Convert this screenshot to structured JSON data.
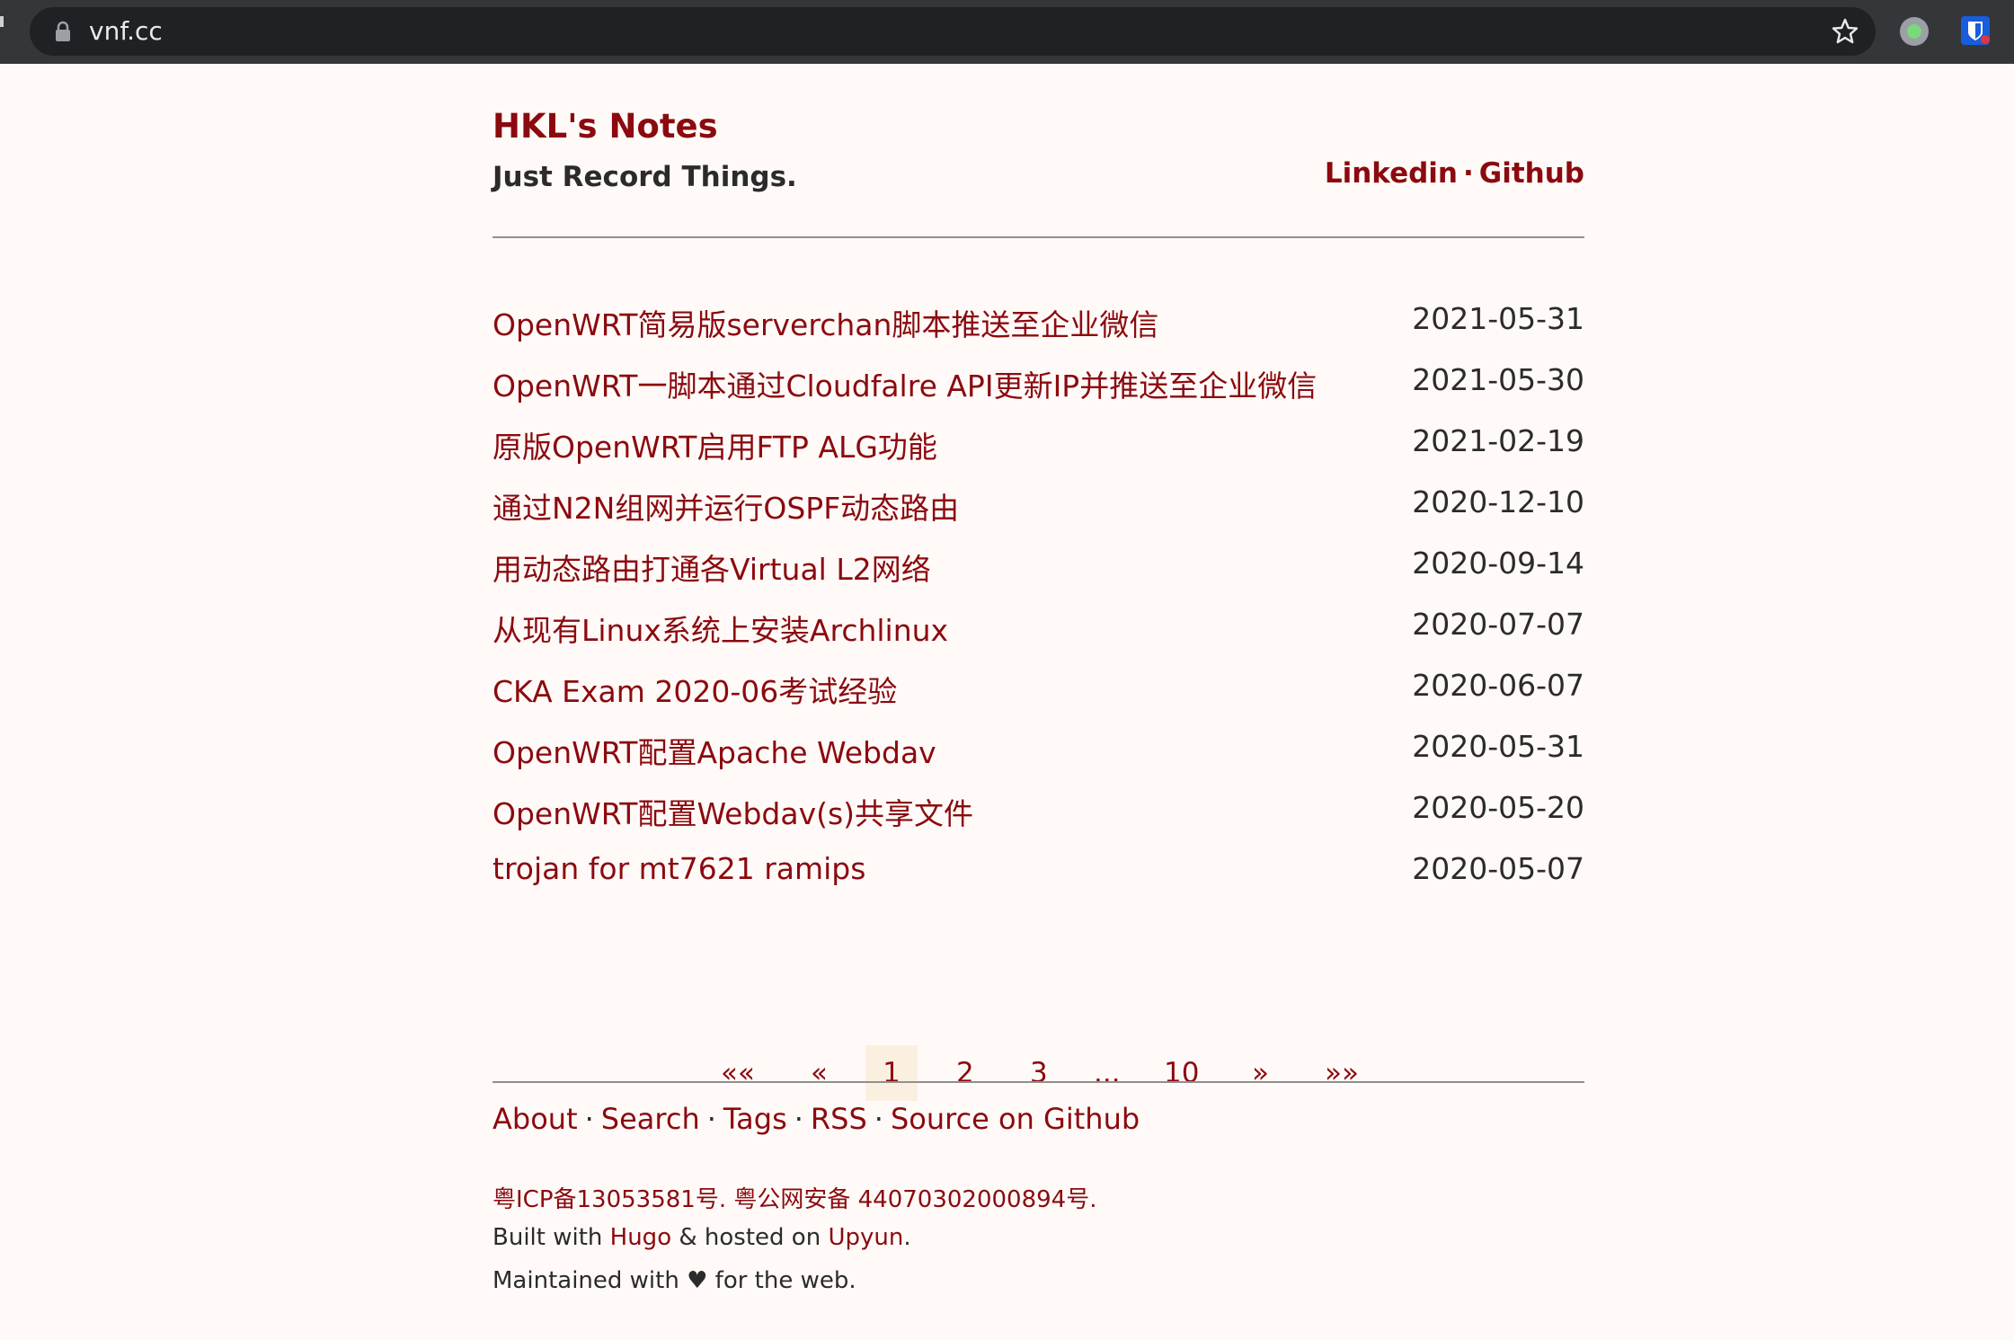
{
  "browser": {
    "url": "vnf.cc"
  },
  "header": {
    "title": "HKL's Notes",
    "subtitle": "Just Record Things.",
    "links": [
      "Linkedin",
      "Github"
    ],
    "separator": "·"
  },
  "posts": [
    {
      "title": "OpenWRT简易版serverchan脚本推送至企业微信",
      "date": "2021-05-31"
    },
    {
      "title": "OpenWRT一脚本通过Cloudfalre API更新IP并推送至企业微信",
      "date": "2021-05-30"
    },
    {
      "title": "原版OpenWRT启用FTP ALG功能",
      "date": "2021-02-19"
    },
    {
      "title": "通过N2N组网并运行OSPF动态路由",
      "date": "2020-12-10"
    },
    {
      "title": "用动态路由打通各Virtual L2网络",
      "date": "2020-09-14"
    },
    {
      "title": "从现有Linux系统上安装Archlinux",
      "date": "2020-07-07"
    },
    {
      "title": "CKA Exam 2020-06考试经验",
      "date": "2020-06-07"
    },
    {
      "title": "OpenWRT配置Apache Webdav",
      "date": "2020-05-31"
    },
    {
      "title": "OpenWRT配置Webdav(s)共享文件",
      "date": "2020-05-20"
    },
    {
      "title": "trojan for mt7621 ramips",
      "date": "2020-05-07"
    }
  ],
  "pagination": {
    "first": "««",
    "prev": "«",
    "pages": [
      "1",
      "2",
      "3"
    ],
    "ellipsis": "...",
    "last_page": "10",
    "next": "»",
    "last": "»»",
    "current": "1"
  },
  "footer": {
    "nav": [
      "About",
      "Search",
      "Tags",
      "RSS",
      "Source on Github"
    ],
    "separator": "·",
    "icp": "粤ICP备13053581号. 粤公网安备 44070302000894号.",
    "built_prefix": "Built with ",
    "built_hugo": "Hugo",
    "built_mid": " & hosted on ",
    "built_upyun": "Upyun",
    "built_suffix": ".",
    "maintained_prefix": "Maintained with ",
    "heart": "♥",
    "maintained_suffix": " for the web."
  },
  "colors": {
    "accent": "#8b0a0f",
    "background": "#fffaf8",
    "text": "#2b2b2b",
    "active_page_bg": "#fbefe0"
  }
}
